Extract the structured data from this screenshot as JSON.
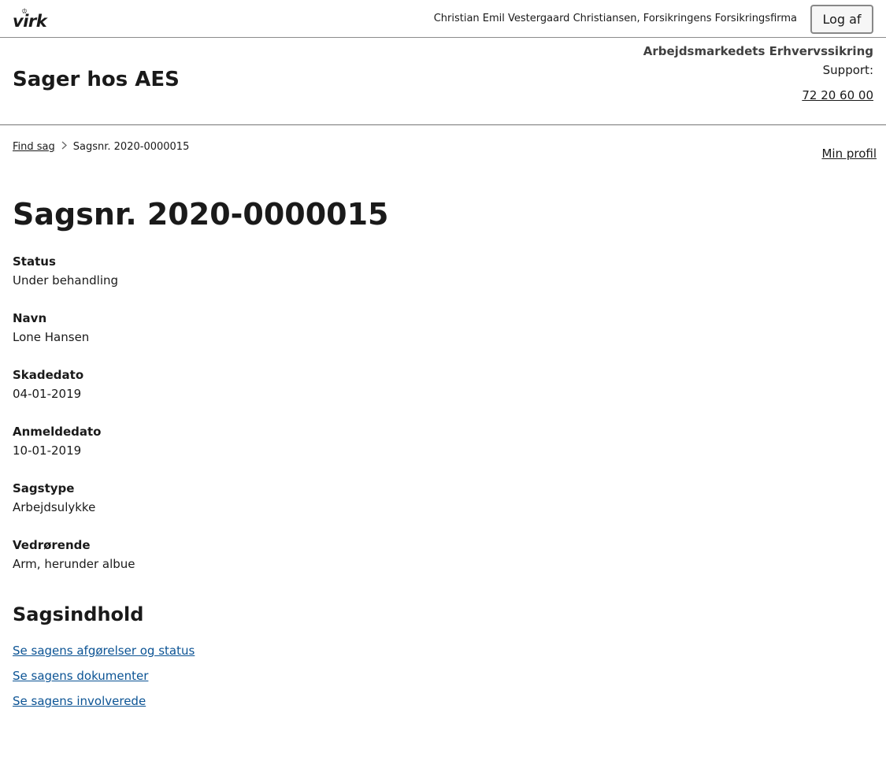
{
  "topbar": {
    "logo_text": "virk",
    "user": "Christian Emil Vestergaard Christiansen, Forsikringens Forsikringsfirma",
    "logout_label": "Log af"
  },
  "header": {
    "title": "Sager hos AES",
    "authority": "Arbejdsmarkedets Erhvervssikring",
    "support_label": "Support:",
    "support_phone": "72 20 60 00"
  },
  "breadcrumb": {
    "home": "Find sag",
    "current": "Sagsnr. 2020-0000015"
  },
  "profile_link": "Min profil",
  "case": {
    "title": "Sagsnr. 2020-0000015",
    "fields": [
      {
        "label": "Status",
        "value": "Under behandling"
      },
      {
        "label": "Navn",
        "value": "Lone Hansen"
      },
      {
        "label": "Skadedato",
        "value": "04-01-2019"
      },
      {
        "label": "Anmeldedato",
        "value": "10-01-2019"
      },
      {
        "label": "Sagstype",
        "value": "Arbejdsulykke"
      },
      {
        "label": "Vedrørende",
        "value": "Arm, herunder albue"
      }
    ]
  },
  "content": {
    "title": "Sagsindhold",
    "links": [
      "Se sagens afgørelser og status",
      "Se sagens dokumenter",
      "Se sagens involverede"
    ]
  },
  "colors": {
    "link": "#0b5394",
    "divider": "#8c8c8c"
  }
}
